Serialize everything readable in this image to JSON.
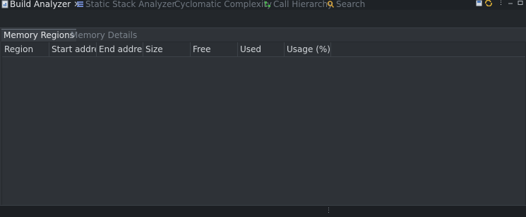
{
  "view_tabs": [
    {
      "label": "Build Analyzer",
      "icon": "document-chart-icon",
      "active": true
    },
    {
      "label": "Static Stack Analyzer",
      "icon": "stack-analyzer-icon",
      "active": false
    },
    {
      "label": "Cyclomatic Complexity",
      "icon": "",
      "active": false
    },
    {
      "label": "Call Hierarchy",
      "icon": "call-hierarchy-icon",
      "active": false
    },
    {
      "label": "Search",
      "icon": "search-icon",
      "active": false
    }
  ],
  "close_glyph": "✕",
  "inner_tabs": [
    "Memory Regions",
    "Memory Details"
  ],
  "table": {
    "columns": [
      "Region",
      "Start addre",
      "End addres",
      "Size",
      "Free",
      "Used",
      "Usage (%)"
    ]
  },
  "colors": {
    "accent_search": "#d9a43a",
    "accent_hierarchy": "#4caf50",
    "accent_stack": "#6d86c9"
  }
}
